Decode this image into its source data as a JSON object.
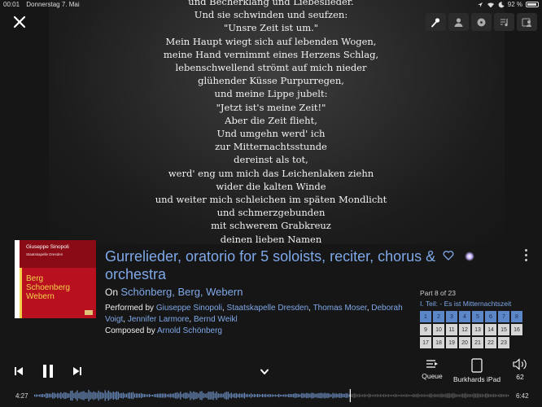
{
  "status_bar": {
    "time": "00:01",
    "date": "Donnerstag 7. Mai",
    "battery_text": "92 %",
    "battery_level": 0.92
  },
  "lyrics": [
    "und Becherklang und Liebeslieder.",
    "Und sie schwinden und seufzen:",
    "\"Unsre Zeit ist um.\"",
    "Mein Haupt wiegt sich auf lebenden Wogen,",
    "meine Hand vernimmt eines Herzens Schlag,",
    "lebenschwellend strömt auf mich nieder",
    "glühender Küsse Purpurregen,",
    "und meine Lippe jubelt:",
    "\"Jetzt ist's meine Zeit!\"",
    "Aber die Zeit flieht,",
    "Und umgehn werd' ich",
    "zur Mitternachtsstunde",
    "dereinst als tot,",
    "werd' eng um mich das Leichenlaken ziehn",
    "wider die kalten Winde",
    "und weiter mich schleichen im späten Mondlicht",
    "und schmerzgebunden",
    "mit schwerem Grabkreuz",
    "deinen lieben Namen"
  ],
  "cover": {
    "artist": "Giuseppe Sinopoli",
    "orchestra": "Staatskapelle Dresden",
    "title_lines": [
      "Berg",
      "Schoenberg",
      "Webern"
    ]
  },
  "track": {
    "title": "Gurrelieder, oratorio for 5 soloists, reciter, chorus & orchestra",
    "on_prefix": "On",
    "album": "Schönberg, Berg, Webern",
    "performed_prefix": "Performed by",
    "performers": [
      "Giuseppe Sinopoli",
      "Staatskapelle Dresden",
      "Thomas Moser",
      "Deborah Voigt",
      "Jennifer Larmore",
      "Bernd Weikl"
    ],
    "composed_prefix": "Composed by",
    "composer": "Arnold Schönberg"
  },
  "parts": {
    "label": "Part 8 of 23",
    "current_name": "I. Teil: - Es ist Mitternachtszeit",
    "total": 23,
    "current": 8
  },
  "player": {
    "queue_label": "Queue",
    "device_label": "Burkhards iPad",
    "volume_label": "62",
    "elapsed": "4:27",
    "total": "6:42",
    "progress": 0.664
  },
  "colors": {
    "accent": "#7fa8e8",
    "played_cell": "#5b86c7"
  }
}
